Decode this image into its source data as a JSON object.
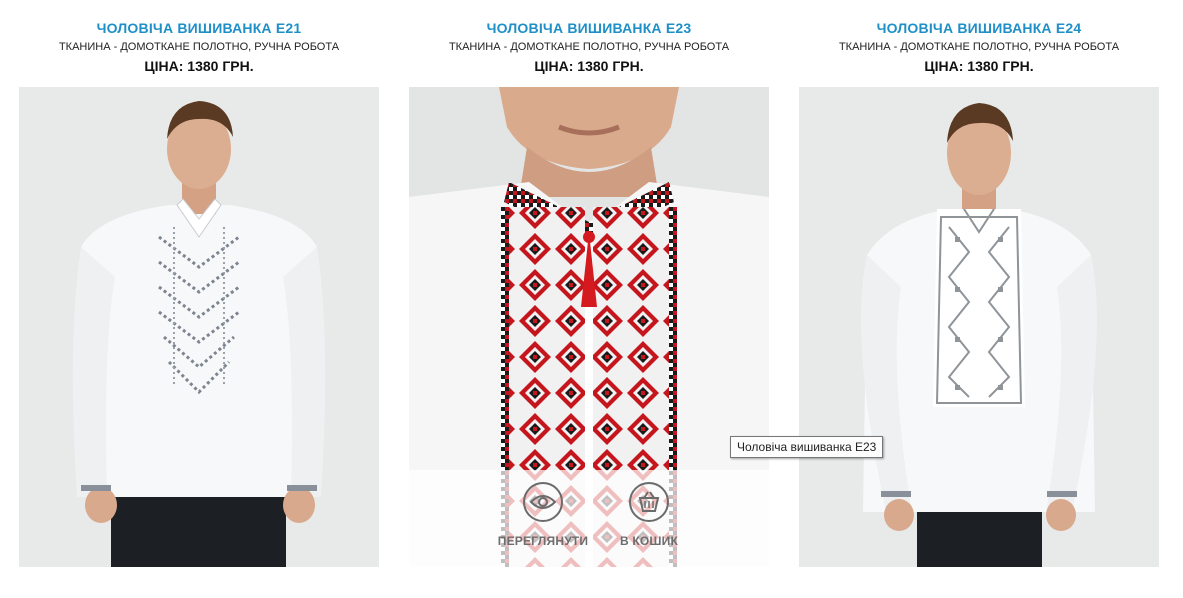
{
  "products": [
    {
      "title": "ЧОЛОВІЧА ВИШИВАНКА E21",
      "subtitle": "ТКАНИНА - ДОМОТКАНЕ ПОЛОТНО, РУЧНА РОБОТА",
      "price": "ЦІНА: 1380 ГРН."
    },
    {
      "title": "ЧОЛОВІЧА ВИШИВАНКА E23",
      "subtitle": "ТКАНИНА - ДОМОТКАНЕ ПОЛОТНО, РУЧНА РОБОТА",
      "price": "ЦІНА: 1380 ГРН."
    },
    {
      "title": "ЧОЛОВІЧА ВИШИВАНКА E24",
      "subtitle": "ТКАНИНА - ДОМОТКАНЕ ПОЛОТНО, РУЧНА РОБОТА",
      "price": "ЦІНА: 1380 ГРН."
    }
  ],
  "hover_actions": {
    "view_label": "ПЕРЕГЛЯНУТИ",
    "view_icon": "eye-icon",
    "cart_label": "В КОШИК",
    "cart_icon": "basket-icon"
  },
  "tooltip": "Чоловіча вишиванка E23",
  "colors": {
    "title_link": "#1e8fc7",
    "embroidery_red": "#c4161c",
    "embroidery_black": "#1a1a1a",
    "embroidery_grey": "#8f9499"
  }
}
